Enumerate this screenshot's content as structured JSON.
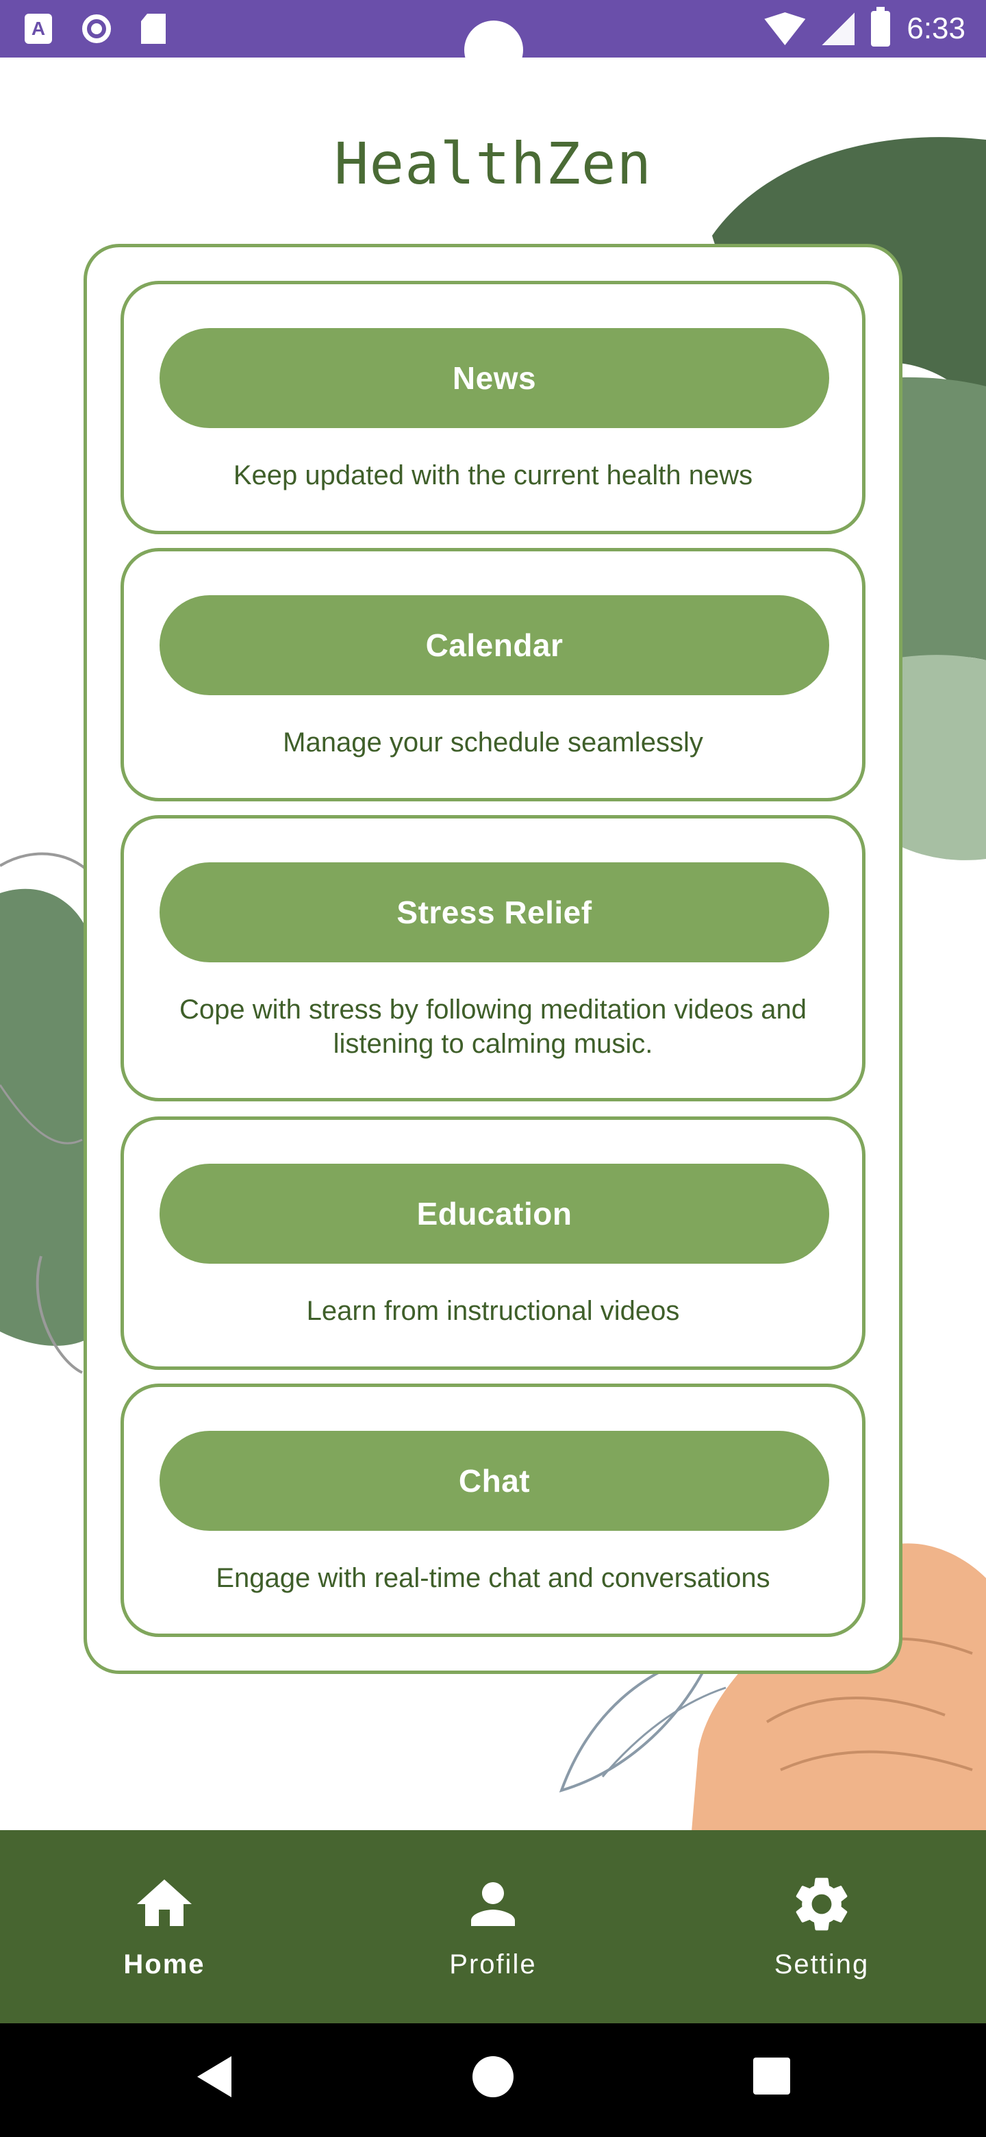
{
  "status_bar": {
    "time": "6:33",
    "left_icons": [
      "a-icon",
      "record-icon",
      "sd-card-icon"
    ],
    "right_icons": [
      "wifi-icon",
      "signal-icon",
      "battery-icon"
    ]
  },
  "app": {
    "title": "HealthZen"
  },
  "cards": [
    {
      "button": "News",
      "description": "Keep updated with the current health news"
    },
    {
      "button": "Calendar",
      "description": "Manage your schedule seamlessly"
    },
    {
      "button": "Stress Relief",
      "description": "Cope with stress by following meditation videos and listening to calming music."
    },
    {
      "button": "Education",
      "description": "Learn from instructional videos"
    },
    {
      "button": "Chat",
      "description": "Engage with real-time chat and conversations"
    }
  ],
  "bottom_nav": {
    "items": [
      {
        "label": "Home",
        "icon": "home-icon",
        "active": true
      },
      {
        "label": "Profile",
        "icon": "person-icon",
        "active": false
      },
      {
        "label": "Setting",
        "icon": "gear-icon",
        "active": false
      }
    ]
  },
  "system_nav": [
    "back-icon",
    "home-circle-icon",
    "recents-icon"
  ],
  "colors": {
    "status_bar": "#6a4faa",
    "accent_green": "#80a65c",
    "dark_green": "#476530",
    "title_green": "#4a6b35",
    "peach": "#f0b48a"
  }
}
